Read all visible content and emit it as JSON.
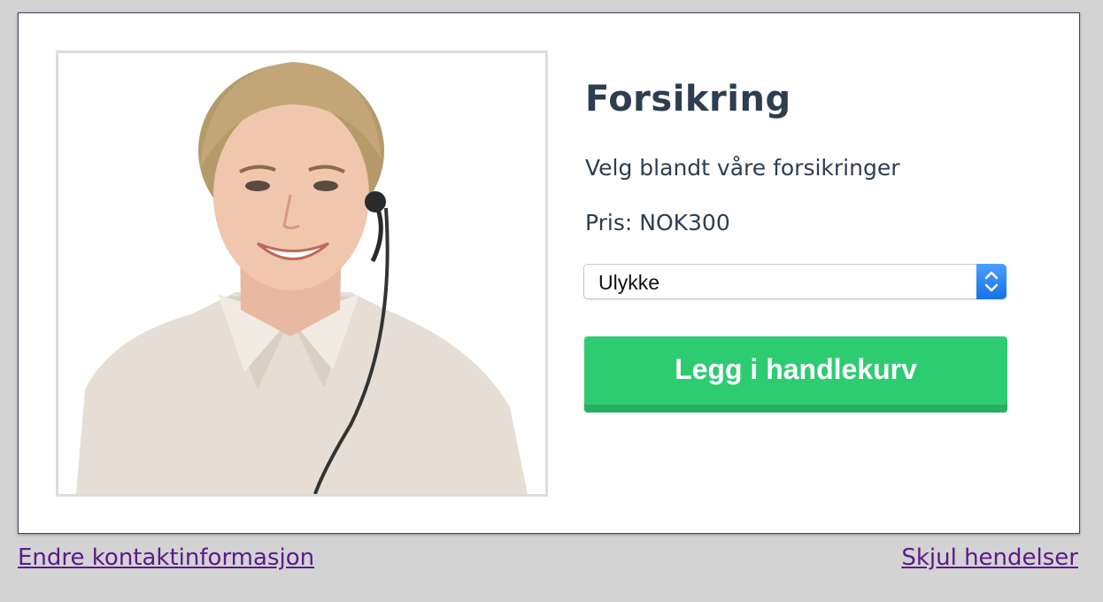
{
  "product": {
    "title": "Forsikring",
    "description": "Velg blandt våre forsikringer",
    "price": "Pris: NOK300",
    "select": {
      "selected": "Ulykke"
    },
    "add_to_cart_label": "Legg i handlekurv"
  },
  "footer": {
    "left_link": "Endre kontaktinformasjon",
    "right_link": "Skjul hendelser"
  },
  "colors": {
    "text_dark": "#2c3e50",
    "button_green": "#2ecc71",
    "button_green_shadow": "#27ae60",
    "link_purple": "#5a1a8c",
    "page_background": "#d3d3d3",
    "select_arrow_blue": "#1673e6"
  },
  "icons": {
    "select_arrows": "updown-chevron-icon"
  }
}
